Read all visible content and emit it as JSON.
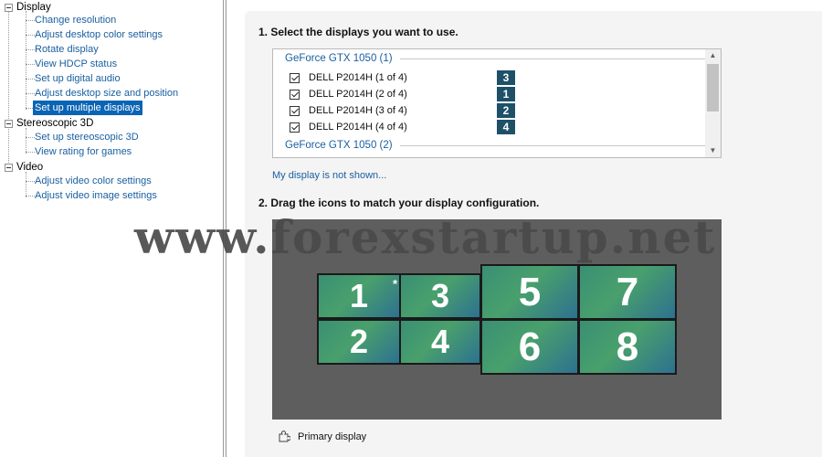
{
  "tree": {
    "categories": [
      {
        "label": "Display",
        "items": [
          "Change resolution",
          "Adjust desktop color settings",
          "Rotate display",
          "View HDCP status",
          "Set up digital audio",
          "Adjust desktop size and position",
          "Set up multiple displays"
        ]
      },
      {
        "label": "Stereoscopic 3D",
        "items": [
          "Set up stereoscopic 3D",
          "View rating for games"
        ]
      },
      {
        "label": "Video",
        "items": [
          "Adjust video color settings",
          "Adjust video image settings"
        ]
      }
    ],
    "selected": "Set up multiple displays"
  },
  "step1": {
    "title": "1. Select the displays you want to use.",
    "groups": [
      "GeForce GTX 1050 (1)",
      "GeForce GTX 1050 (2)"
    ],
    "displays": [
      {
        "label": "DELL P2014H (1 of 4)",
        "badge": "3",
        "checked": true
      },
      {
        "label": "DELL P2014H (2 of 4)",
        "badge": "1",
        "checked": true
      },
      {
        "label": "DELL P2014H (3 of 4)",
        "badge": "2",
        "checked": true
      },
      {
        "label": "DELL P2014H (4 of 4)",
        "badge": "4",
        "checked": true
      }
    ],
    "link": "My display is not shown..."
  },
  "step2": {
    "title": "2. Drag the icons to match your display configuration.",
    "monitors": [
      "1",
      "3",
      "5",
      "7",
      "2",
      "4",
      "6",
      "8"
    ],
    "primary_marker": "*"
  },
  "legend": {
    "primary_label": "Primary display"
  },
  "watermark": "www.forexstartup.net",
  "colors": {
    "selection": "#0a64b4",
    "link": "#1a5fa0",
    "badge": "#1e5168",
    "canvas": "#5e5e5e"
  }
}
